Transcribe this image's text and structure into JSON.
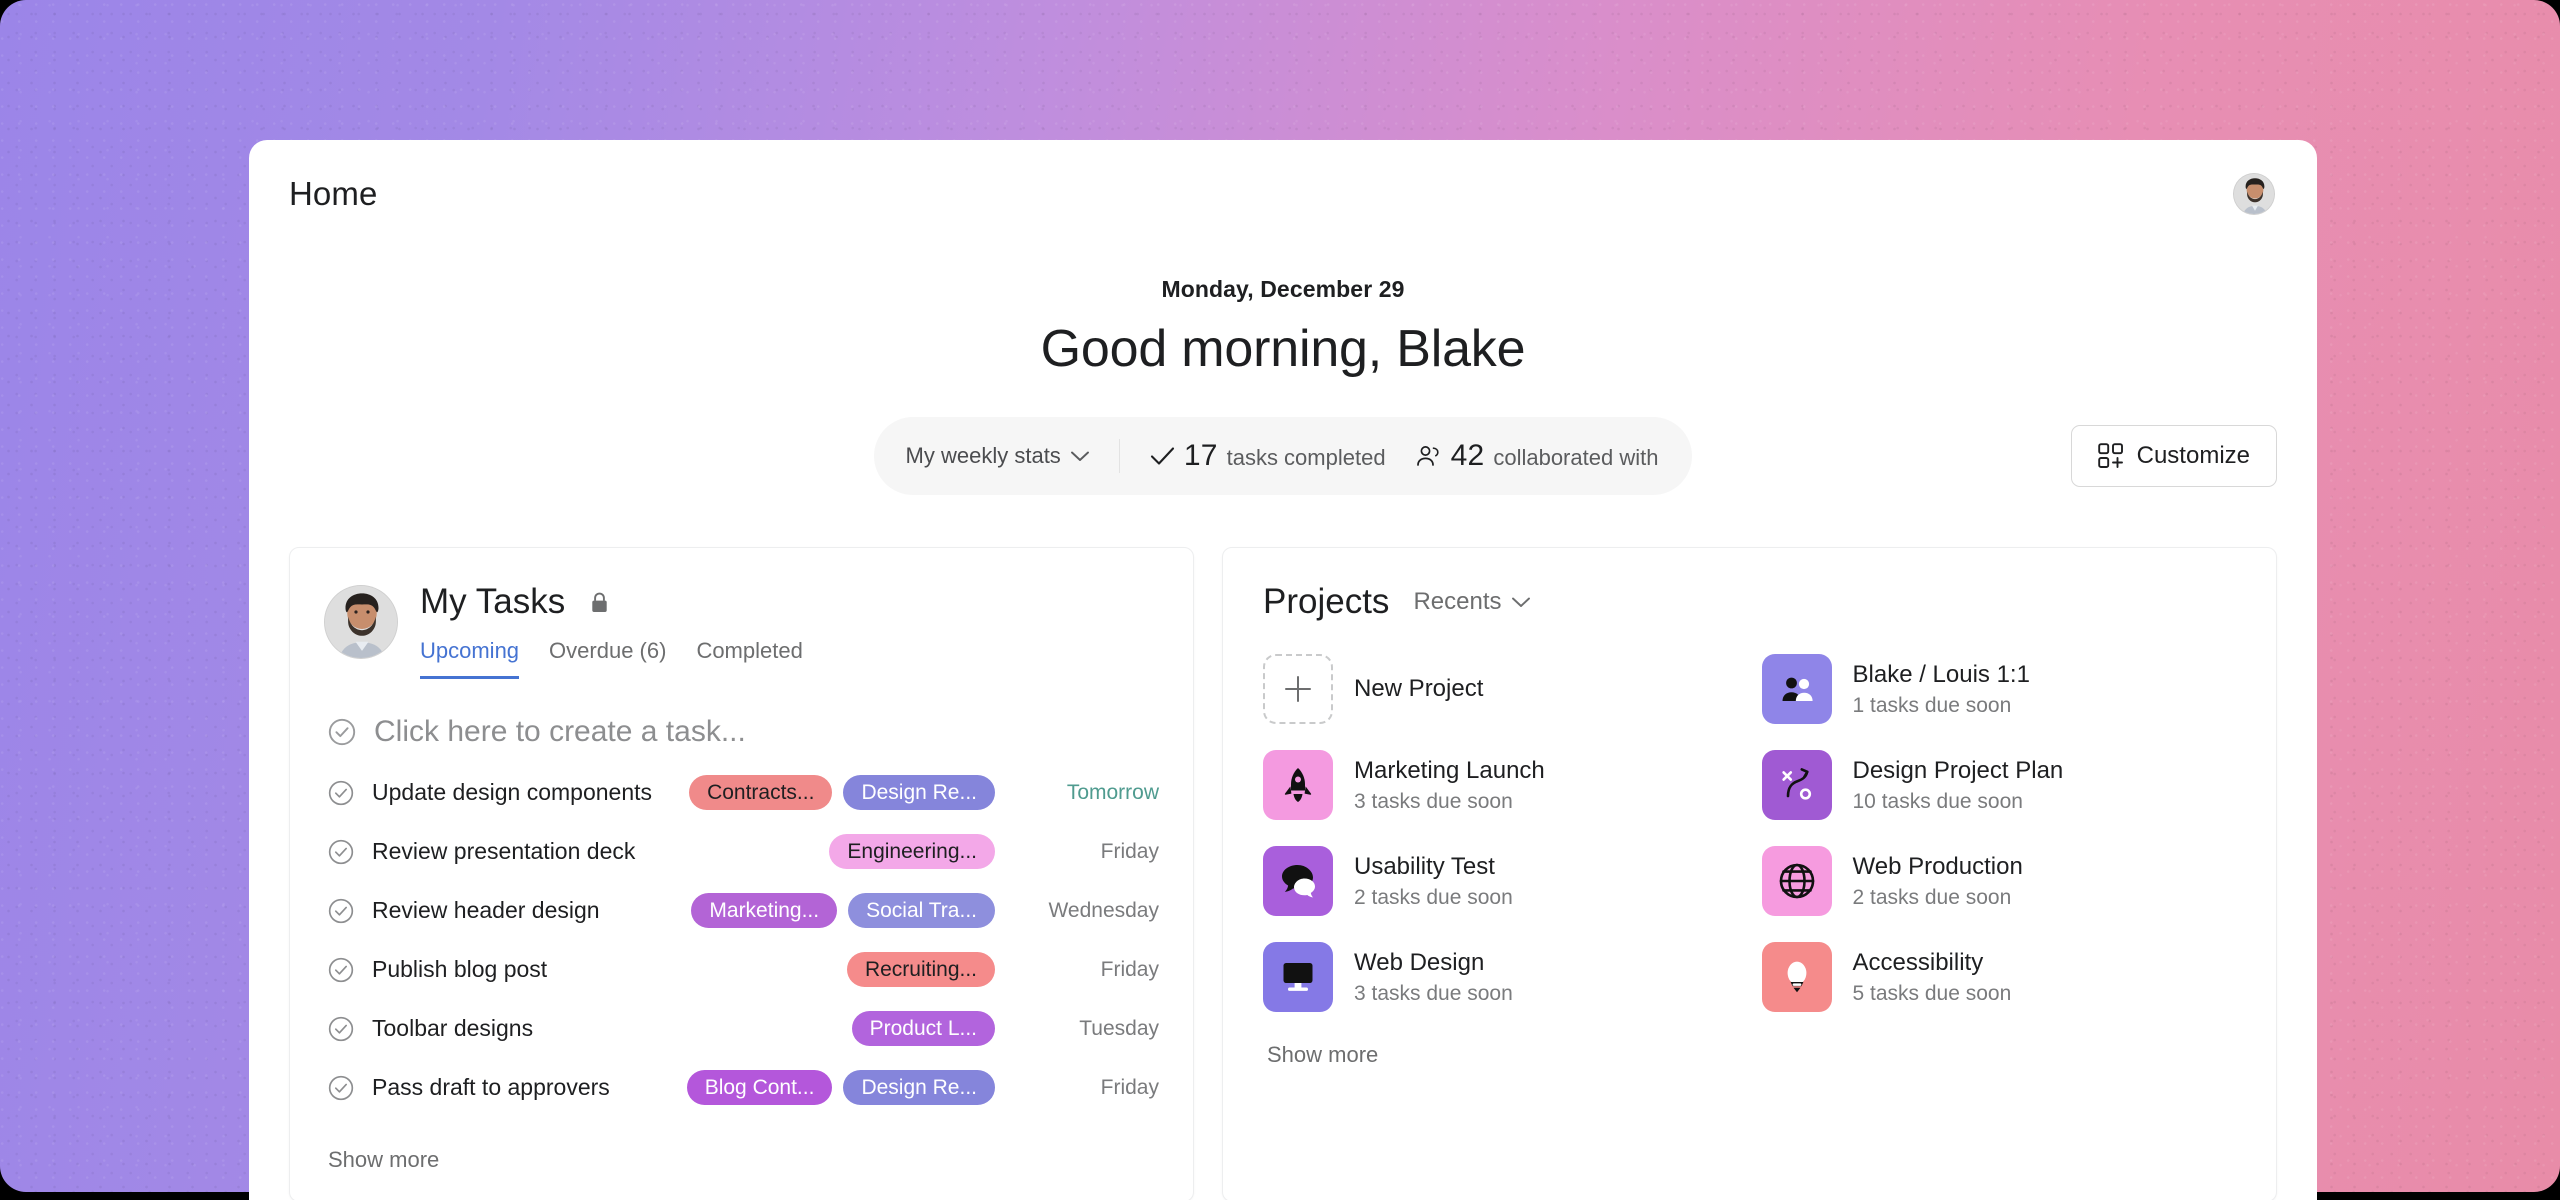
{
  "background": {
    "gradient_from": "#9b85e8",
    "gradient_to": "#e88ca8"
  },
  "topbar": {
    "title": "Home",
    "avatar_name": "user-avatar"
  },
  "greeting": {
    "date": "Monday, December 29",
    "message": "Good morning, Blake"
  },
  "stats": {
    "selector_label": "My weekly stats",
    "items": [
      {
        "icon": "check-icon",
        "value": "17",
        "label": "tasks completed"
      },
      {
        "icon": "people-icon",
        "value": "42",
        "label": "collaborated with"
      }
    ]
  },
  "customize": {
    "label": "Customize",
    "icon": "grid-plus-icon"
  },
  "my_tasks": {
    "title": "My Tasks",
    "privacy_icon": "lock-icon",
    "tabs": [
      {
        "label": "Upcoming",
        "active": true
      },
      {
        "label": "Overdue (6)",
        "active": false
      },
      {
        "label": "Completed",
        "active": false
      }
    ],
    "create_placeholder": "Click here to create a task...",
    "show_more": "Show more",
    "rows": [
      {
        "name": "Update design components",
        "tags": [
          {
            "label": "Contracts...",
            "bg": "#f08a8a",
            "fg": "#1e1f21"
          },
          {
            "label": "Design Re...",
            "bg": "#8585db",
            "fg": "#ffffff"
          }
        ],
        "due": "Tomorrow",
        "due_soon": true
      },
      {
        "name": "Review presentation deck",
        "tags": [
          {
            "label": "Engineering...",
            "bg": "#f3a8e8",
            "fg": "#1e1f21"
          }
        ],
        "due": "Friday",
        "due_soon": false
      },
      {
        "name": "Review header design",
        "tags": [
          {
            "label": "Marketing...",
            "bg": "#b364d6",
            "fg": "#ffffff"
          },
          {
            "label": "Social Tra...",
            "bg": "#8e8fdd",
            "fg": "#ffffff"
          }
        ],
        "due": "Wednesday",
        "due_soon": false
      },
      {
        "name": "Publish blog post",
        "tags": [
          {
            "label": "Recruiting...",
            "bg": "#f58b8b",
            "fg": "#1e1f21"
          }
        ],
        "due": "Friday",
        "due_soon": false
      },
      {
        "name": "Toolbar designs",
        "tags": [
          {
            "label": "Product L...",
            "bg": "#b264dd",
            "fg": "#ffffff"
          }
        ],
        "due": "Tuesday",
        "due_soon": false
      },
      {
        "name": "Pass draft to approvers",
        "tags": [
          {
            "label": "Blog Cont...",
            "bg": "#b457db",
            "fg": "#ffffff"
          },
          {
            "label": "Design Re...",
            "bg": "#8585db",
            "fg": "#ffffff"
          }
        ],
        "due": "Friday",
        "due_soon": false
      }
    ]
  },
  "projects": {
    "title": "Projects",
    "sort_label": "Recents",
    "new_project_label": "New Project",
    "show_more": "Show more",
    "items": [
      {
        "name": "Blake / Louis 1:1",
        "sub": "1 tasks due soon",
        "icon": "people-icon",
        "bg": "#8f85e8"
      },
      {
        "name": "Marketing Launch",
        "sub": "3 tasks due soon",
        "icon": "rocket-icon",
        "bg": "#f49ae0"
      },
      {
        "name": "Design Project Plan",
        "sub": "10 tasks due soon",
        "icon": "flow-chart-icon",
        "bg": "#a05ad3"
      },
      {
        "name": "Usability Test",
        "sub": "2 tasks due soon",
        "icon": "speech-bubbles-icon",
        "bg": "#a95fdc"
      },
      {
        "name": "Web Production",
        "sub": "2 tasks due soon",
        "icon": "globe-icon",
        "bg": "#f69bdf"
      },
      {
        "name": "Web Design",
        "sub": "3 tasks due soon",
        "icon": "monitor-icon",
        "bg": "#8579e6"
      },
      {
        "name": "Accessibility",
        "sub": "5 tasks due soon",
        "icon": "lightbulb-icon",
        "bg": "#f58b8b"
      }
    ]
  }
}
